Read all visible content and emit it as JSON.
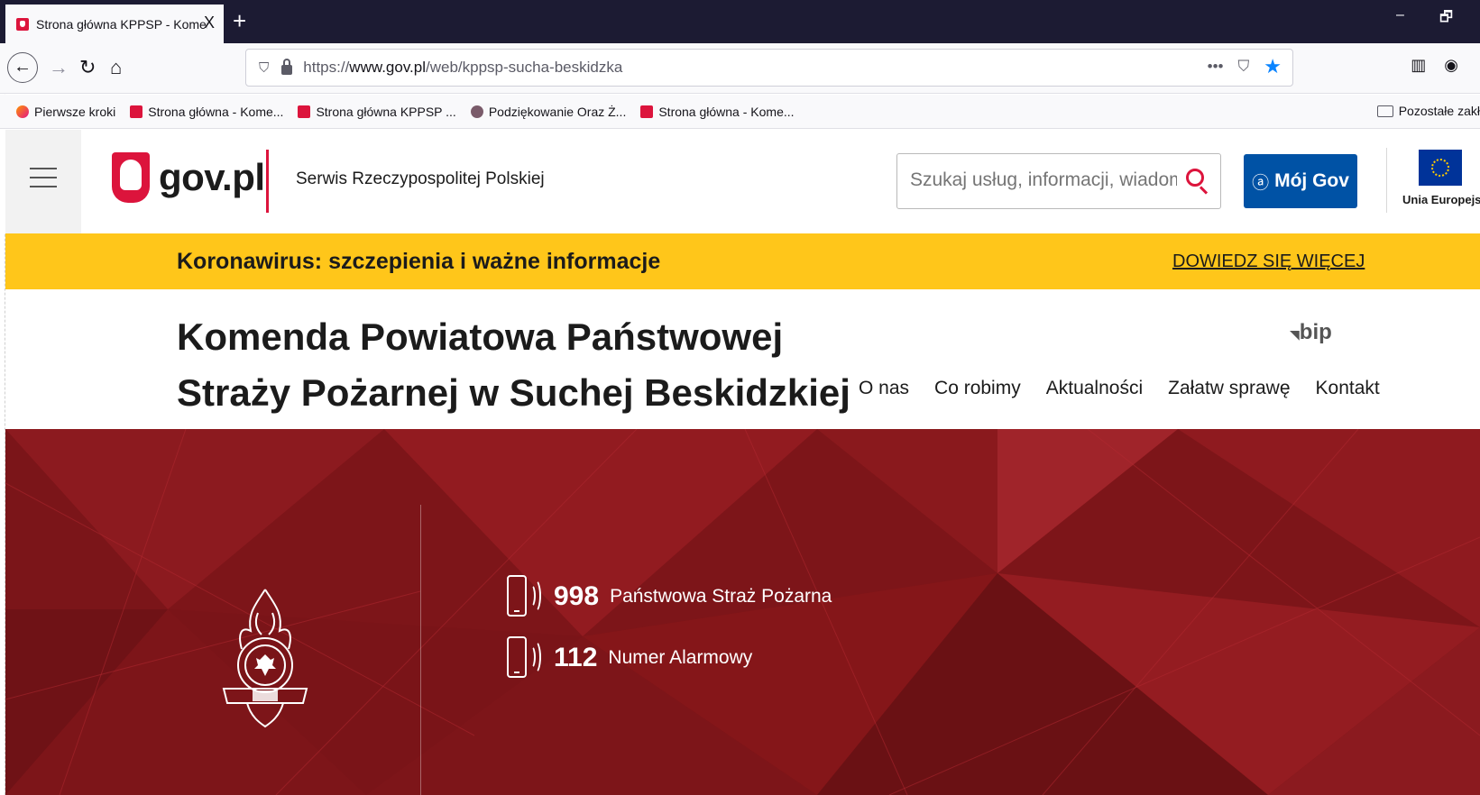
{
  "browser": {
    "tab_title": "Strona główna KPPSP - Komenda",
    "tab_close": "X",
    "new_tab": "+",
    "window_minimize": "–",
    "window_restore": "🗗",
    "url_prefix": "https://",
    "url_domain": "www.gov.pl",
    "url_path": "/web/kppsp-sucha-beskidzka",
    "url_more": "•••",
    "bookmarks": [
      {
        "label": "Pierwsze kroki",
        "icon": "firefox-icon"
      },
      {
        "label": "Strona główna - Kome...",
        "icon": "gov-favicon"
      },
      {
        "label": "Strona główna KPPSP ...",
        "icon": "gov-favicon"
      },
      {
        "label": "Podziękowanie Oraz Ż...",
        "icon": "cog-favicon"
      },
      {
        "label": "Strona główna - Kome...",
        "icon": "gov-favicon"
      }
    ],
    "other_bookmarks": "Pozostałe zakł"
  },
  "header": {
    "brand": "gov.pl",
    "service_name": "Serwis Rzeczypospolitej Polskiej",
    "search_placeholder": "Szukaj usług, informacji, wiadomości",
    "login_label": "Mój Gov",
    "eu_label": "Unia Europejska"
  },
  "banner": {
    "text": "Koronawirus: szczepienia i ważne informacje",
    "link": "DOWIEDZ SIĘ WIĘCEJ"
  },
  "page": {
    "title": "Komenda Powiatowa Państwowej Straży Pożarnej w Suchej Beskidzkiej",
    "bip": "bip",
    "nav": [
      "O nas",
      "Co robimy",
      "Aktualności",
      "Załatw sprawę",
      "Kontakt"
    ]
  },
  "hero": {
    "phones": [
      {
        "number": "998",
        "label": "Państwowa Straż Pożarna"
      },
      {
        "number": "112",
        "label": "Numer Alarmowy"
      }
    ]
  },
  "colors": {
    "gov_red": "#dc143c",
    "gov_blue": "#0052a5",
    "banner_yellow": "#ffc61a",
    "hero_red": "#7d1519"
  }
}
